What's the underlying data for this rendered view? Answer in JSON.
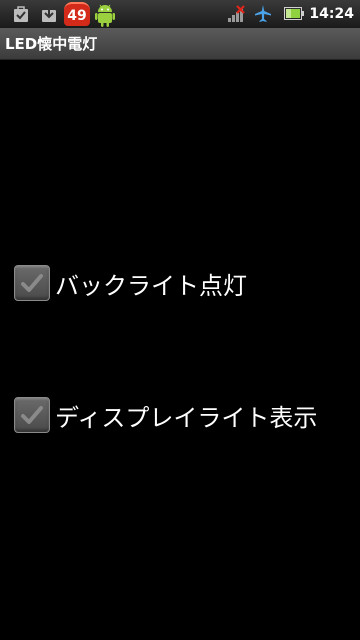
{
  "status_bar": {
    "notification_count": "49",
    "time": "14:24",
    "icons": [
      "checklist-bag-icon",
      "download-icon",
      "notification-count-badge",
      "android-icon",
      "no-signal-icon",
      "airplane-icon",
      "battery-icon"
    ]
  },
  "app_bar": {
    "title": "LED懐中電灯"
  },
  "options": [
    {
      "label": "バックライト点灯",
      "checked": true
    },
    {
      "label": "ディスプレイライト表示",
      "checked": true
    }
  ],
  "colors": {
    "background": "#000000",
    "badge": "#d42a1a",
    "text": "#ffffff"
  }
}
